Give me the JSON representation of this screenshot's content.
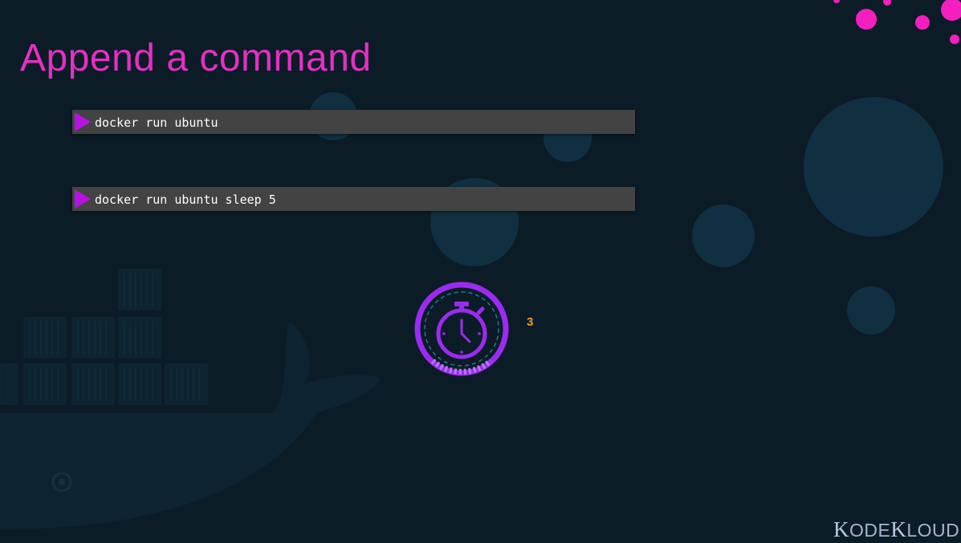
{
  "slide": {
    "title": "Append a command",
    "accent_color": "#e52fc4",
    "background_color": "#0b1c27"
  },
  "commands": [
    {
      "prompt_icon": "play-arrow-icon",
      "text": "docker run ubuntu"
    },
    {
      "prompt_icon": "play-arrow-icon",
      "text": "docker run ubuntu sleep 5"
    }
  ],
  "timer": {
    "icon": "stopwatch-icon",
    "countdown_value": "3",
    "countdown_color": "#f39a1d",
    "ring_color": "#9b2bf0"
  },
  "logo": {
    "brand_name": "KODEKLOUD",
    "parts": [
      "K",
      "ODE",
      "K",
      "LOUD"
    ]
  }
}
